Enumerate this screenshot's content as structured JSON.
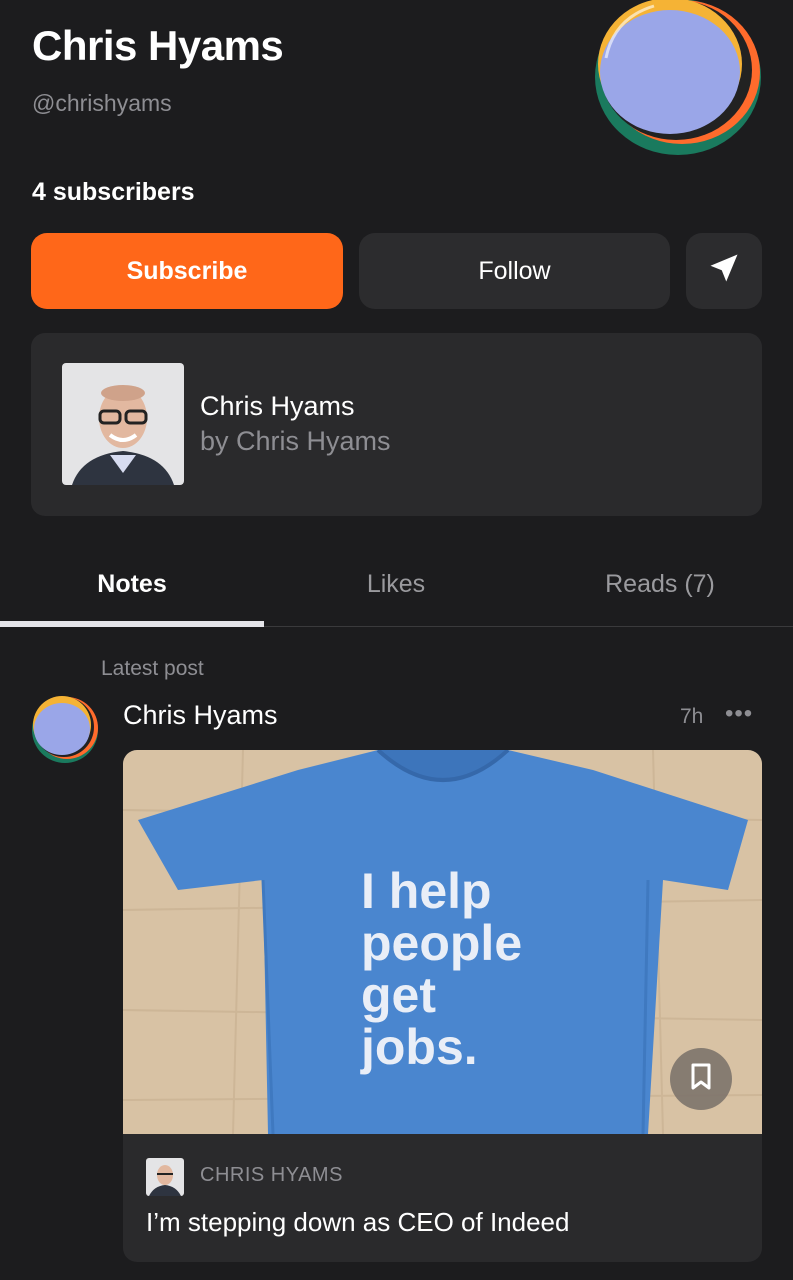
{
  "profile": {
    "name": "Chris Hyams",
    "handle": "@chrishyams",
    "subscribers": "4 subscribers"
  },
  "actions": {
    "subscribe_label": "Subscribe",
    "follow_label": "Follow",
    "share_icon": "send-icon"
  },
  "publication": {
    "title": "Chris Hyams",
    "byline": "by Chris Hyams"
  },
  "tabs": [
    {
      "label": "Notes",
      "active": true
    },
    {
      "label": "Likes",
      "active": false
    },
    {
      "label": "Reads (7)",
      "active": false
    }
  ],
  "feed": {
    "section_label": "Latest post",
    "post": {
      "author": "Chris Hyams",
      "time": "7h",
      "more_label": "•••",
      "image_text": [
        "I help",
        "people",
        "get",
        "jobs."
      ],
      "publication": "CHRIS HYAMS",
      "title": "I’m stepping down as CEO of Indeed"
    }
  },
  "colors": {
    "accent": "#ff6719",
    "background": "#1c1c1e",
    "card": "#2a2a2c"
  }
}
